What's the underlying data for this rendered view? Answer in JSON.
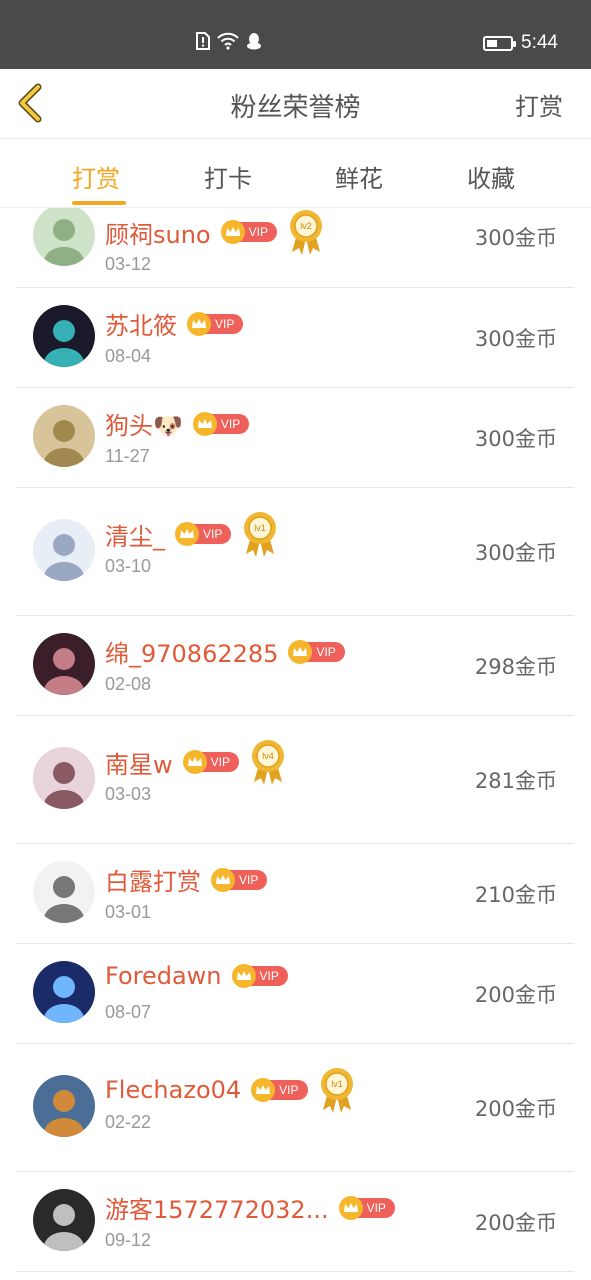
{
  "status_bar": {
    "time": "5:44",
    "battery_level": 0.45
  },
  "header": {
    "title": "粉丝荣誉榜",
    "right_action": "打赏"
  },
  "tabs": [
    {
      "label": "打赏",
      "active": true
    },
    {
      "label": "打卡",
      "active": false
    },
    {
      "label": "鲜花",
      "active": false
    },
    {
      "label": "收藏",
      "active": false
    }
  ],
  "vip_label": "VIP",
  "rows": [
    {
      "name": "顾祠suno",
      "date": "03-12",
      "amount": "300金币",
      "medal": "lv2"
    },
    {
      "name": "苏北筱",
      "date": "08-04",
      "amount": "300金币",
      "medal": ""
    },
    {
      "name": "狗头🐶",
      "date": "11-27",
      "amount": "300金币",
      "medal": ""
    },
    {
      "name": "清尘_",
      "date": "03-10",
      "amount": "300金币",
      "medal": "lv1"
    },
    {
      "name": "绵_970862285",
      "date": "02-08",
      "amount": "298金币",
      "medal": ""
    },
    {
      "name": "南星w",
      "date": "03-03",
      "amount": "281金币",
      "medal": "lv4"
    },
    {
      "name": "白露打赏",
      "date": "03-01",
      "amount": "210金币",
      "medal": ""
    },
    {
      "name": "Foredawn",
      "date": "08-07",
      "amount": "200金币",
      "medal": ""
    },
    {
      "name": "Flechazo04",
      "date": "02-22",
      "amount": "200金币",
      "medal": "lv1"
    },
    {
      "name": "游客1572772032...",
      "date": "09-12",
      "amount": "200金币",
      "medal": ""
    }
  ],
  "colors": {
    "accent": "#f5a623",
    "name": "#e05a3a",
    "vip_badge": "#f0605a",
    "status_bar": "#4a4a4a"
  }
}
